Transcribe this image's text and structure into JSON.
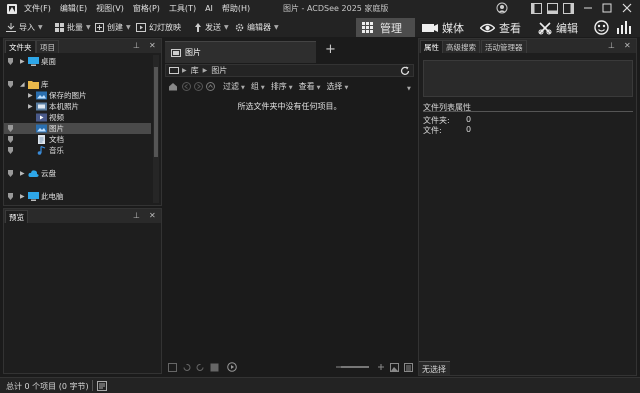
{
  "window": {
    "title": "图片 - ACDSee 2025 家庭版"
  },
  "menu": [
    "文件(F)",
    "编辑(E)",
    "视图(V)",
    "窗格(P)",
    "工具(T)",
    "AI",
    "帮助(H)"
  ],
  "toolbar": {
    "import": "导入",
    "batch": "批量",
    "create": "创建",
    "slideshow": "幻灯放映",
    "send": "发送",
    "editor": "编辑器",
    "modes": {
      "manage": "管理",
      "media": "媒体",
      "view": "查看",
      "edit": "编辑"
    }
  },
  "folders_panel": {
    "tabs": [
      "文件夹",
      "项目"
    ],
    "items": {
      "desktop": "桌面",
      "library": "库",
      "saved_pictures": "保存的图片",
      "camera_roll": "本机照片",
      "videos": "视频",
      "pictures": "图片",
      "documents": "文档",
      "music": "音乐",
      "cloud": "云盘",
      "this_pc": "此电脑"
    }
  },
  "preview_panel": {
    "title": "预览"
  },
  "browser": {
    "tab_label": "图片",
    "add_tab": "+",
    "breadcrumb": [
      "库",
      "图片"
    ],
    "filter_bar": [
      "过滤",
      "组",
      "排序",
      "查看",
      "选择"
    ],
    "empty_message": "所选文件夹中没有任何项目。"
  },
  "properties_panel": {
    "tabs": [
      "属性",
      "高级搜索",
      "活动管理器"
    ],
    "section_title": "文件列表属性",
    "folders_label": "文件夹:",
    "folders_value": "0",
    "files_label": "文件:",
    "files_value": "0",
    "footer": "无选择"
  },
  "statusbar": {
    "text": "总计 0 个项目 (0 字节)"
  }
}
